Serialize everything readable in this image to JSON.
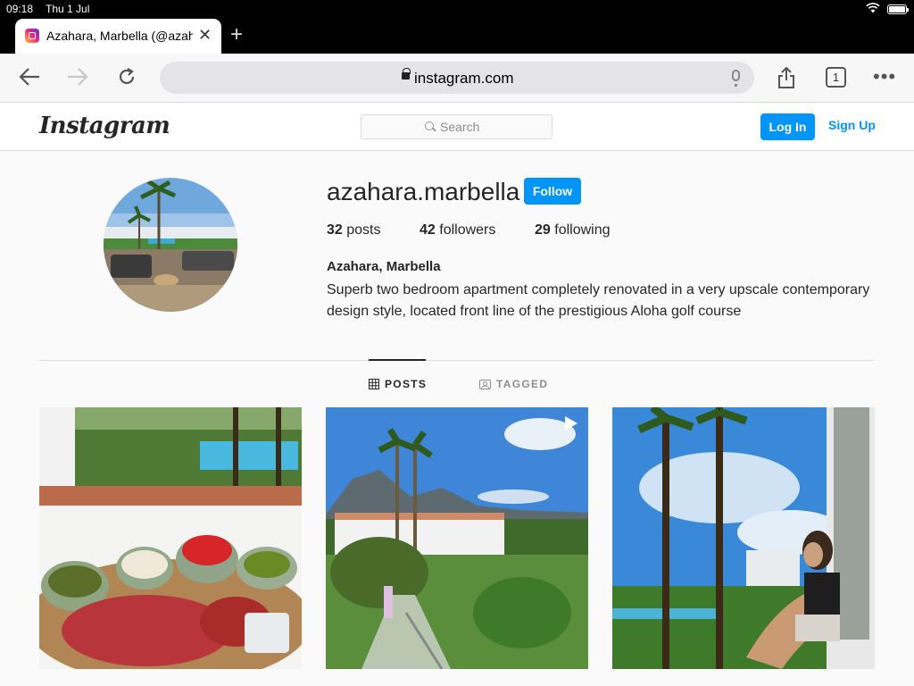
{
  "status": {
    "time": "09:18",
    "date": "Thu 1 Jul"
  },
  "browser": {
    "tab_title": "Azahara, Marbella (@azahara.marbella)",
    "url": "instagram.com",
    "tab_count": "1"
  },
  "header": {
    "logo": "Instagram",
    "search_placeholder": "Search",
    "login_label": "Log In",
    "signup_label": "Sign Up"
  },
  "profile": {
    "username": "azahara.marbella",
    "follow_label": "Follow",
    "posts_count": "32",
    "posts_label": "posts",
    "followers_count": "42",
    "followers_label": "followers",
    "following_count": "29",
    "following_label": "following",
    "full_name": "Azahara, Marbella",
    "bio": "Superb two bedroom apartment completely renovated in a very upscale contemporary design style, located front line of the prestigious Aloha golf course"
  },
  "tabs": {
    "posts": "POSTS",
    "tagged": "TAGGED"
  },
  "colors": {
    "accent": "#0095f6",
    "text": "#262626",
    "border": "#dbdbdb"
  }
}
